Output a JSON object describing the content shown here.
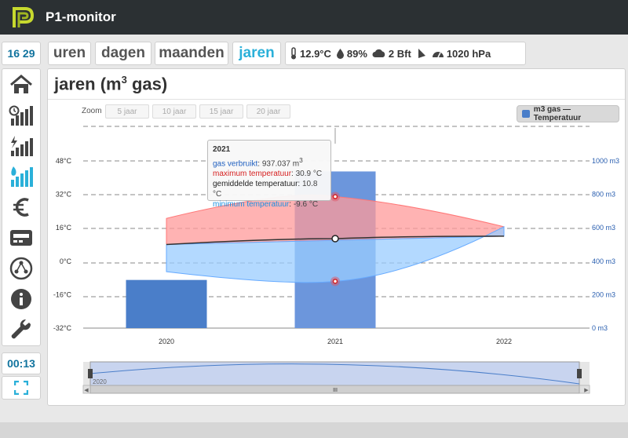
{
  "app": {
    "title": "P1-monitor"
  },
  "clock": "16 29",
  "tabs": [
    {
      "label": "uren",
      "active": false
    },
    {
      "label": "dagen",
      "active": false
    },
    {
      "label": "maanden",
      "active": false
    },
    {
      "label": "jaren",
      "active": true
    }
  ],
  "weather": {
    "temperature": "12.9°C",
    "humidity": "89%",
    "wind": "2 Bft",
    "pressure": "1020 hPa"
  },
  "sidebar": {
    "items": [
      {
        "name": "home-icon",
        "active": false
      },
      {
        "name": "clock-bars-icon",
        "active": false
      },
      {
        "name": "power-bars-icon",
        "active": false
      },
      {
        "name": "gas-bars-icon",
        "active": true
      },
      {
        "name": "euro-icon",
        "active": false
      },
      {
        "name": "meter-icon",
        "active": false
      },
      {
        "name": "network-icon",
        "active": false
      },
      {
        "name": "info-icon",
        "active": false
      },
      {
        "name": "wrench-icon",
        "active": false
      }
    ]
  },
  "timer": "00:13",
  "page": {
    "title_main": "jaren (m",
    "title_sup": "3",
    "title_tail": " gas)"
  },
  "zoom": {
    "label": "Zoom",
    "buttons": [
      "5 jaar",
      "10 jaar",
      "15 jaar",
      "20 jaar"
    ]
  },
  "legend": {
    "label": "m3 gas — Temperatuur"
  },
  "colors": {
    "bar": "#4a7ec9",
    "bar_highlight": "#6c96dc",
    "max_band": "#ff9999",
    "min_band": "#99ccff",
    "avg_line": "#333333",
    "accent": "#2ab0d9"
  },
  "tooltip": {
    "year": "2021",
    "rows": [
      {
        "key": "gas verbruikt",
        "value": "937.037 m",
        "sup": "3"
      },
      {
        "key": "maximum temperatuur",
        "value": "30.9 °C"
      },
      {
        "key": "gemiddelde temperatuur",
        "value": "10.8 °C"
      },
      {
        "key": "minimum temperatuur",
        "value": "-9.6 °C"
      }
    ]
  },
  "navigator": {
    "label": "2020",
    "handle_label": "III"
  },
  "chart_data": {
    "type": "bar",
    "categories": [
      "2020",
      "2021",
      "2022"
    ],
    "gas_values": [
      288,
      937,
      null
    ],
    "temp_max": [
      20.5,
      30.9,
      16.5
    ],
    "temp_avg": [
      8,
      10.8,
      12
    ],
    "temp_min": [
      -5,
      -9.6,
      16.5
    ],
    "y_left": {
      "ticks": [
        "48°C",
        "32°C",
        "16°C",
        "0°C",
        "-16°C",
        "-32°C"
      ],
      "range": [
        -32,
        48
      ]
    },
    "y_right": {
      "ticks": [
        "1000 m3",
        "800 m3",
        "600 m3",
        "400 m3",
        "200 m3",
        "0 m3"
      ],
      "range": [
        0,
        1000
      ]
    }
  }
}
